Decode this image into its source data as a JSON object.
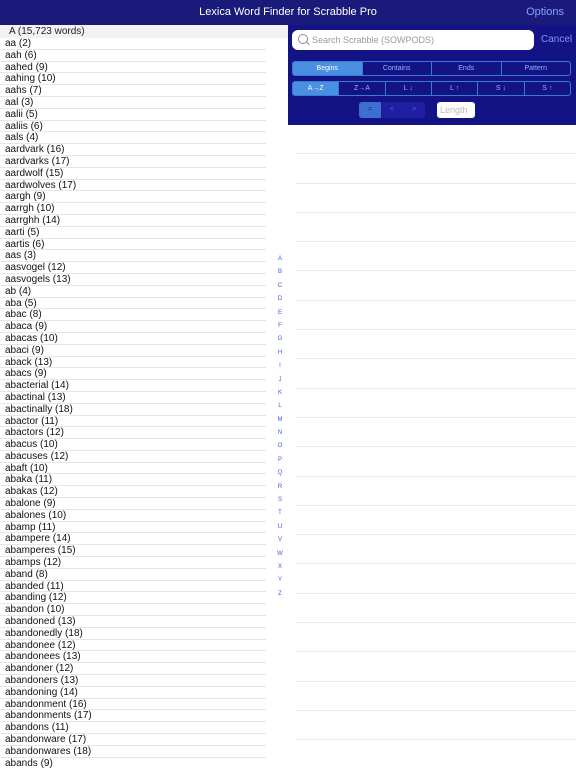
{
  "app": {
    "title": "Lexica Word Finder for Scrabble Pro",
    "options_label": "Options"
  },
  "list": {
    "section_header": "A (15,723 words)",
    "words": [
      "aa  (2)",
      "aah  (6)",
      "aahed  (9)",
      "aahing  (10)",
      "aahs  (7)",
      "aal  (3)",
      "aalii  (5)",
      "aaliis  (6)",
      "aals  (4)",
      "aardvark  (16)",
      "aardvarks  (17)",
      "aardwolf  (15)",
      "aardwolves  (17)",
      "aargh  (9)",
      "aarrgh  (10)",
      "aarrghh  (14)",
      "aarti  (5)",
      "aartis  (6)",
      "aas  (3)",
      "aasvogel  (12)",
      "aasvogels  (13)",
      "ab  (4)",
      "aba  (5)",
      "abac  (8)",
      "abaca  (9)",
      "abacas  (10)",
      "abaci  (9)",
      "aback  (13)",
      "abacs  (9)",
      "abacterial  (14)",
      "abactinal  (13)",
      "abactinally  (18)",
      "abactor  (11)",
      "abactors  (12)",
      "abacus  (10)",
      "abacuses  (12)",
      "abaft  (10)",
      "abaka  (11)",
      "abakas  (12)",
      "abalone  (9)",
      "abalones  (10)",
      "abamp  (11)",
      "abampere  (14)",
      "abamperes  (15)",
      "abamps  (12)",
      "aband  (8)",
      "abanded  (11)",
      "abanding  (12)",
      "abandon  (10)",
      "abandoned  (13)",
      "abandonedly  (18)",
      "abandonee  (12)",
      "abandonees  (13)",
      "abandoner  (12)",
      "abandoners  (13)",
      "abandoning  (14)",
      "abandonment  (16)",
      "abandonments  (17)",
      "abandons  (11)",
      "abandonware  (17)",
      "abandonwares  (18)",
      "abands  (9)"
    ],
    "index_letters": [
      "A",
      "B",
      "C",
      "D",
      "E",
      "F",
      "G",
      "H",
      "I",
      "J",
      "K",
      "L",
      "M",
      "N",
      "O",
      "P",
      "Q",
      "R",
      "S",
      "T",
      "U",
      "V",
      "W",
      "X",
      "Y",
      "Z"
    ]
  },
  "search": {
    "placeholder": "Search Scrabble (SOWPODS)",
    "value": "",
    "cancel_label": "Cancel"
  },
  "modes": [
    {
      "label": "Begins",
      "active": true
    },
    {
      "label": "Contains",
      "active": false
    },
    {
      "label": "Ends",
      "active": false
    },
    {
      "label": "Pattern",
      "active": false
    }
  ],
  "sorts": [
    {
      "label": "A→Z",
      "active": true
    },
    {
      "label": "Z→A",
      "active": false
    },
    {
      "label": "L ↓",
      "active": false
    },
    {
      "label": "L ↑",
      "active": false
    },
    {
      "label": "S ↓",
      "active": false
    },
    {
      "label": "S ↑",
      "active": false
    }
  ],
  "length": {
    "controls": [
      {
        "label": "=",
        "active": true
      },
      {
        "label": "<",
        "active": false
      },
      {
        "label": ">",
        "active": false
      }
    ],
    "placeholder": "Length"
  },
  "colors": {
    "bar": "#1a1a7a",
    "panel": "#131385",
    "accent": "#4a90e2",
    "link": "#7f95ff"
  }
}
